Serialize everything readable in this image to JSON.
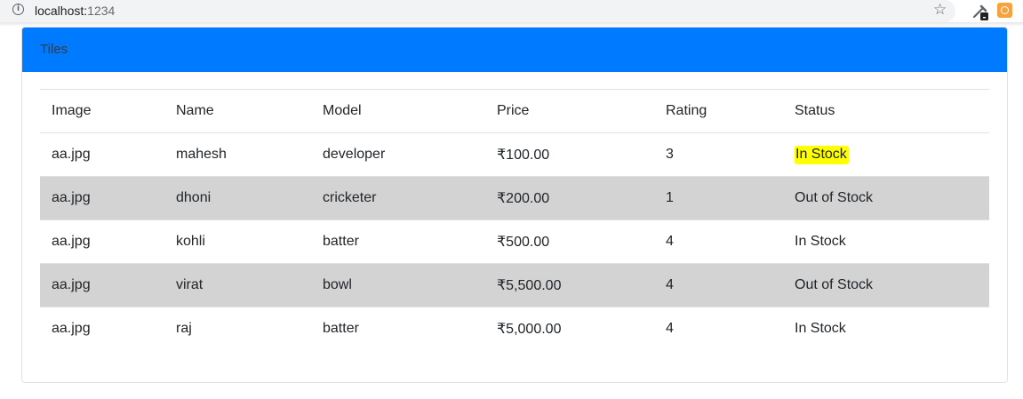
{
  "browser": {
    "url_host": "localhost:",
    "url_port": "1234",
    "icons": [
      "info-icon",
      "star-icon",
      "eyedropper-extension-icon",
      "orange-extension-icon"
    ]
  },
  "card": {
    "title": "Tiles"
  },
  "table": {
    "headers": [
      "Image",
      "Name",
      "Model",
      "Price",
      "Rating",
      "Status"
    ],
    "rows": [
      {
        "image": "aa.jpg",
        "name": "mahesh",
        "model": "developer",
        "price": "₹100.00",
        "rating": "3",
        "status": "In Stock"
      },
      {
        "image": "aa.jpg",
        "name": "dhoni",
        "model": "cricketer",
        "price": "₹200.00",
        "rating": "1",
        "status": "Out of Stock"
      },
      {
        "image": "aa.jpg",
        "name": "kohli",
        "model": "batter",
        "price": "₹500.00",
        "rating": "4",
        "status": "In Stock"
      },
      {
        "image": "aa.jpg",
        "name": "virat",
        "model": "bowl",
        "price": "₹5,500.00",
        "rating": "4",
        "status": "Out of Stock"
      },
      {
        "image": "aa.jpg",
        "name": "raj",
        "model": "batter",
        "price": "₹5,000.00",
        "rating": "4",
        "status": "In Stock"
      }
    ]
  },
  "colors": {
    "header_blue": "#007bff",
    "zebra_gray": "#d3d3d3",
    "highlight_yellow": "#ffff00"
  }
}
